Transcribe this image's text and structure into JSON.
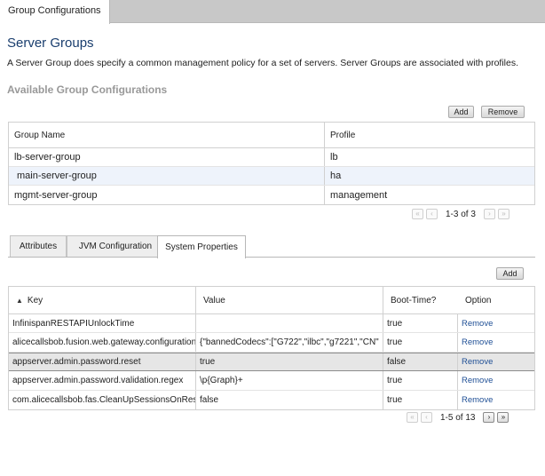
{
  "top_tab": {
    "label": "Group Configurations"
  },
  "page": {
    "title": "Server Groups",
    "description": "A Server Group does specify a common management policy for a set of servers. Server Groups are associated with profiles.",
    "subtitle": "Available Group Configurations"
  },
  "group_toolbar": {
    "add_label": "Add",
    "remove_label": "Remove"
  },
  "group_table": {
    "columns": [
      "Group Name",
      "Profile"
    ],
    "rows": [
      {
        "name": "lb-server-group",
        "profile": "lb"
      },
      {
        "name": "main-server-group",
        "profile": "ha"
      },
      {
        "name": "mgmt-server-group",
        "profile": "management"
      }
    ],
    "pager_text": "1-3 of 3"
  },
  "sub_tabs": [
    {
      "label": "Attributes"
    },
    {
      "label": "JVM Configuration"
    },
    {
      "label": "System Properties"
    }
  ],
  "props_toolbar": {
    "add_label": "Add"
  },
  "props_table": {
    "columns": [
      "Key",
      "Value",
      "Boot-Time?",
      "Option"
    ],
    "sort_icon": "sort-ascending-icon",
    "rows": [
      {
        "key": "InfinispanRESTAPIUnlockTime",
        "value": "",
        "boot": "true",
        "option": "Remove"
      },
      {
        "key": "alicecallsbob.fusion.web.gateway.configuration",
        "value": "{\"bannedCodecs\":[\"G722\",\"ilbc\",\"g7221\",\"CN\"",
        "boot": "true",
        "option": "Remove"
      },
      {
        "key": "appserver.admin.password.reset",
        "value": "true",
        "boot": "false",
        "option": "Remove"
      },
      {
        "key": "appserver.admin.password.validation.regex",
        "value": "\\p{Graph}+",
        "boot": "true",
        "option": "Remove"
      },
      {
        "key": "com.alicecallsbob.fas.CleanUpSessionsOnRestart",
        "value": "false",
        "boot": "true",
        "option": "Remove"
      }
    ],
    "pager_text": "1-5 of 13"
  },
  "colors": {
    "title": "#1a3e6e",
    "subtitle": "#999999",
    "link": "#1f4f95",
    "alt_row": "#eef3fb",
    "selected_row": "#e6e6e6"
  }
}
